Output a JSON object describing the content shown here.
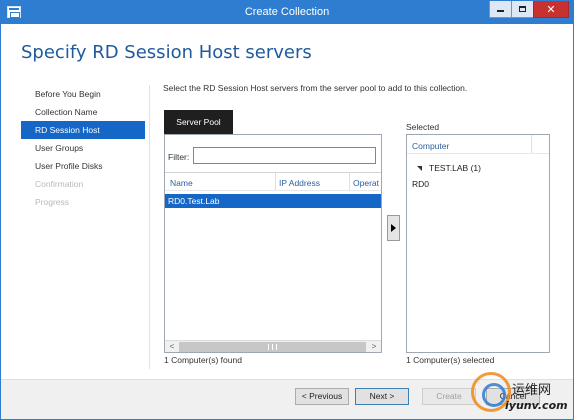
{
  "window": {
    "title": "Create Collection",
    "close_glyph": "✕"
  },
  "page": {
    "title": "Specify RD Session Host servers",
    "instruction": "Select the RD Session Host servers from the server pool to add to this collection."
  },
  "steps": [
    {
      "label": "Before You Begin",
      "state": "normal"
    },
    {
      "label": "Collection Name",
      "state": "normal"
    },
    {
      "label": "RD Session Host",
      "state": "active"
    },
    {
      "label": "User Groups",
      "state": "normal"
    },
    {
      "label": "User Profile Disks",
      "state": "normal"
    },
    {
      "label": "Confirmation",
      "state": "disabled"
    },
    {
      "label": "Progress",
      "state": "disabled"
    }
  ],
  "server_pool": {
    "tab_label": "Server Pool",
    "filter_label": "Filter:",
    "filter_value": "",
    "columns": [
      "Name",
      "IP Address",
      "Operat"
    ],
    "rows": [
      {
        "name": "RD0.Test.Lab",
        "selected": true
      }
    ],
    "count_text": "1 Computer(s) found",
    "scroll_left": "<",
    "scroll_right": ">"
  },
  "selected": {
    "label": "Selected",
    "column": "Computer",
    "group": "TEST.LAB (1)",
    "servers": [
      "RD0"
    ],
    "count_text": "1 Computer(s) selected"
  },
  "buttons": {
    "previous": "< Previous",
    "next": "Next >",
    "create": "Create",
    "cancel": "Cancel"
  },
  "watermark": {
    "cn": "运维网",
    "url": "iyunv.com"
  },
  "colors": {
    "title_bar": "#2f7dd0",
    "accent": "#1467c7",
    "page_title": "#1e5a9e",
    "close_button": "#c7312f"
  },
  "icons": [
    "app-icon",
    "minimize-icon",
    "maximize-icon",
    "close-icon",
    "move-right-icon",
    "expand-collapse-icon"
  ]
}
